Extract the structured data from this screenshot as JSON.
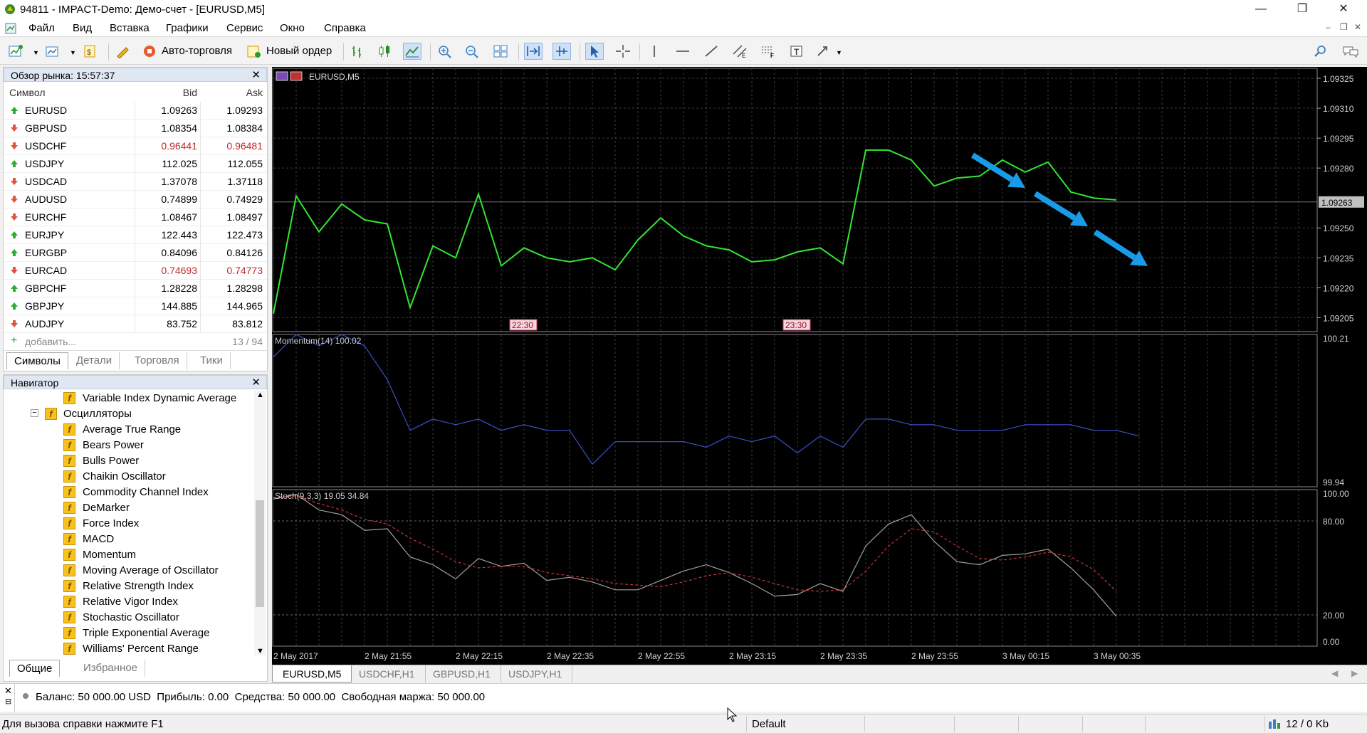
{
  "window": {
    "title": "94811 - IMPACT-Demo: Демо-счет - [EURUSD,M5]",
    "controls": [
      "—",
      "❐",
      "✕"
    ],
    "mdi_controls": [
      "–",
      "❐",
      "✕"
    ]
  },
  "menu": [
    "Файл",
    "Вид",
    "Вставка",
    "Графики",
    "Сервис",
    "Окно",
    "Справка"
  ],
  "toolbar": {
    "auto_trading": "Авто-торговля",
    "new_order": "Новый ордер"
  },
  "market_watch": {
    "title": "Обзор рынка: 15:57:37",
    "col_symbol": "Символ",
    "col_bid": "Bid",
    "col_ask": "Ask",
    "rows": [
      {
        "symbol": "EURUSD",
        "bid": "1.09263",
        "ask": "1.09293",
        "dir": "up",
        "red": false
      },
      {
        "symbol": "GBPUSD",
        "bid": "1.08354",
        "ask": "1.08384",
        "dir": "down",
        "red": false
      },
      {
        "symbol": "USDCHF",
        "bid": "0.96441",
        "ask": "0.96481",
        "dir": "down",
        "red": true
      },
      {
        "symbol": "USDJPY",
        "bid": "112.025",
        "ask": "112.055",
        "dir": "up",
        "red": false
      },
      {
        "symbol": "USDCAD",
        "bid": "1.37078",
        "ask": "1.37118",
        "dir": "down",
        "red": false
      },
      {
        "symbol": "AUDUSD",
        "bid": "0.74899",
        "ask": "0.74929",
        "dir": "down",
        "red": false
      },
      {
        "symbol": "EURCHF",
        "bid": "1.08467",
        "ask": "1.08497",
        "dir": "down",
        "red": false
      },
      {
        "symbol": "EURJPY",
        "bid": "122.443",
        "ask": "122.473",
        "dir": "up",
        "red": false
      },
      {
        "symbol": "EURGBP",
        "bid": "0.84096",
        "ask": "0.84126",
        "dir": "up",
        "red": false
      },
      {
        "symbol": "EURCAD",
        "bid": "0.74693",
        "ask": "0.74773",
        "dir": "down",
        "red": true
      },
      {
        "symbol": "GBPCHF",
        "bid": "1.28228",
        "ask": "1.28298",
        "dir": "up",
        "red": false
      },
      {
        "symbol": "GBPJPY",
        "bid": "144.885",
        "ask": "144.965",
        "dir": "up",
        "red": false
      },
      {
        "symbol": "AUDJPY",
        "bid": "83.752",
        "ask": "83.812",
        "dir": "down",
        "red": false
      }
    ],
    "add_label": "добавить...",
    "count": "13 / 94",
    "tabs": [
      "Символы",
      "Детали",
      "Торговля",
      "Тики"
    ]
  },
  "navigator": {
    "title": "Навигатор",
    "top_item": "Variable Index Dynamic Average",
    "group": "Осцилляторы",
    "items": [
      "Average True Range",
      "Bears Power",
      "Bulls Power",
      "Chaikin Oscillator",
      "Commodity Channel Index",
      "DeMarker",
      "Force Index",
      "MACD",
      "Momentum",
      "Moving Average of Oscillator",
      "Relative Strength Index",
      "Relative Vigor Index",
      "Stochastic Oscillator",
      "Triple Exponential Average",
      "Williams' Percent Range"
    ],
    "tabs": [
      "Общие",
      "Избранное"
    ]
  },
  "chart": {
    "symbol_label": "EURUSD,M5",
    "price_ticks": [
      "1.09325",
      "1.09310",
      "1.09295",
      "1.09280",
      "1.09250",
      "1.09235",
      "1.09220",
      "1.09205"
    ],
    "current_price": "1.09263",
    "time_markers": [
      "22:30",
      "23:30"
    ],
    "momentum_label": "Momentum(14) 100.02",
    "momentum_ticks": [
      "100.21",
      "99.94"
    ],
    "stoch_label": "Stoch(9,3,3) 19.05 34.84",
    "stoch_ticks": [
      "100.00",
      "80.00",
      "20.00",
      "0.00"
    ],
    "time_ticks": [
      "2 May 2017",
      "2 May 21:55",
      "2 May 22:15",
      "2 May 22:35",
      "2 May 22:55",
      "2 May 23:15",
      "2 May 23:35",
      "2 May 23:55",
      "3 May 00:15",
      "3 May 00:35"
    ],
    "tabs": [
      "EURUSD,M5",
      "USDCHF,H1",
      "GBPUSD,H1",
      "USDJPY,H1"
    ],
    "colors": {
      "price": "#32e632",
      "momentum": "#3c50c8",
      "stoch_main": "#a0a0a0",
      "stoch_signal": "#c83232",
      "arrows": "#1a9be8",
      "grid": "#3a3a3a"
    }
  },
  "chart_data": [
    {
      "type": "line",
      "title": "EURUSD,M5",
      "x": [
        "2 May 2017",
        "2 May 21:55",
        "2 May 22:15",
        "2 May 22:35",
        "2 May 22:55",
        "2 May 23:15",
        "2 May 23:35",
        "2 May 23:55",
        "3 May 00:15",
        "3 May 00:35"
      ],
      "series": [
        {
          "values": [
            1.09207,
            1.09266,
            1.09248,
            1.09262,
            1.09254,
            1.09252,
            1.0921,
            1.09241,
            1.09235,
            1.09267,
            1.09231,
            1.0924,
            1.09235,
            1.09233,
            1.09235,
            1.09229,
            1.09244,
            1.09255,
            1.09246,
            1.09241,
            1.09239,
            1.09233,
            1.09234,
            1.09238,
            1.0924,
            1.09232,
            1.09289,
            1.09289,
            1.09284,
            1.09271,
            1.09275,
            1.09276,
            1.09284,
            1.09278,
            1.09283,
            1.09268,
            1.09265,
            1.09264
          ]
        }
      ],
      "ylim": [
        1.09198,
        1.0933
      ]
    },
    {
      "type": "line",
      "title": "Momentum(14) 100.02",
      "series": [
        {
          "values": [
            100.17,
            100.21,
            100.19,
            100.21,
            100.19,
            100.13,
            100.04,
            100.06,
            100.05,
            100.06,
            100.04,
            100.05,
            100.04,
            100.04,
            99.98,
            100.02,
            100.02,
            100.02,
            100.02,
            100.01,
            100.03,
            100.02,
            100.03,
            100.0,
            100.03,
            100.01,
            100.06,
            100.06,
            100.05,
            100.05,
            100.04,
            100.04,
            100.04,
            100.05,
            100.05,
            100.05,
            100.04,
            100.04,
            100.03
          ]
        }
      ],
      "ylim": [
        99.94,
        100.21
      ]
    },
    {
      "type": "line",
      "title": "Stoch(9,3,3) 19.05 34.84",
      "series": [
        {
          "values": [
            94,
            97,
            87,
            84,
            74,
            75,
            57,
            52,
            43,
            56,
            51,
            53,
            42,
            44,
            41,
            36,
            36,
            42,
            48,
            52,
            47,
            40,
            32,
            33,
            40,
            35,
            64,
            78,
            84,
            67,
            54,
            52,
            58,
            59,
            62,
            50,
            36,
            19
          ]
        },
        {
          "values": [
            95,
            96,
            91,
            87,
            81,
            78,
            69,
            62,
            54,
            50,
            51,
            51,
            47,
            45,
            43,
            40,
            39,
            38,
            41,
            45,
            47,
            44,
            40,
            36,
            35,
            36,
            48,
            64,
            75,
            73,
            64,
            56,
            55,
            57,
            60,
            57,
            49,
            35
          ]
        }
      ],
      "ylim": [
        0,
        100
      ]
    }
  ],
  "terminal": {
    "summary": "Баланс: 50 000.00 USD  Прибыль: 0.00  Средства: 50 000.00  Свободная маржа: 50 000.00"
  },
  "status": {
    "help": "Для вызова справки нажмите F1",
    "profile": "Default",
    "traffic": "12 / 0 Kb"
  }
}
